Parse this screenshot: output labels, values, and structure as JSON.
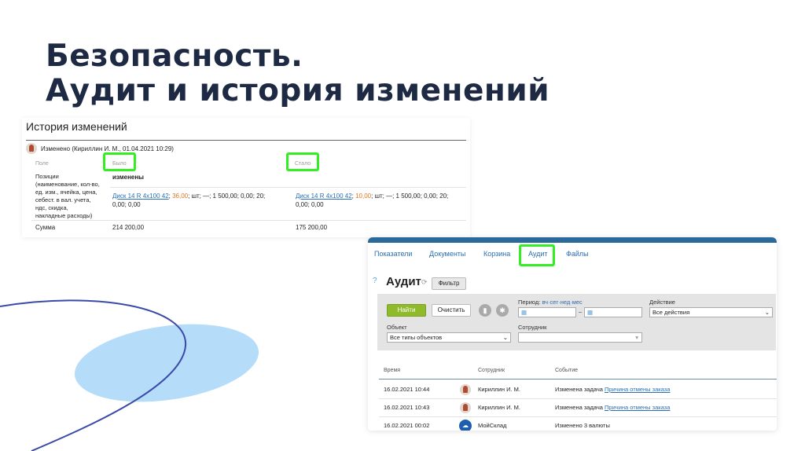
{
  "slide": {
    "title_line1": "Безопасность.",
    "title_line2": "Аудит и история изменений"
  },
  "history": {
    "title": "История изменений",
    "changed_by": "Изменено (Кириллин И. М., 01.04.2021 10:29)",
    "col_field": "Поле",
    "col_was": "Было",
    "col_became": "Стало",
    "positions_label": "Позиции (наименование, кол-во, ед. изм., ячейка, цена, себест. в вал. учета, ндс, скидка, накладные расходы)",
    "positions_status": "изменены",
    "was": {
      "link": "Диск 14 R 4x100 42",
      "sep": "; ",
      "qty": "36,00",
      "rest": "; шт; —; 1 500,00; 0,00; 20;",
      "rest2": "0,00; 0,00"
    },
    "became": {
      "link": "Диск 14 R 4x100 42",
      "sep": "; ",
      "qty": "10,00",
      "rest": "; шт; —; 1 500,00; 0,00; 20;",
      "rest2": "0,00; 0,00"
    },
    "sum_label": "Сумма",
    "sum_was": "214 200,00",
    "sum_became": "175 200,00"
  },
  "audit": {
    "tabs": [
      "Показатели",
      "Документы",
      "Корзина",
      "Аудит",
      "Файлы"
    ],
    "active_tab": "Аудит",
    "heading": "Аудит",
    "filter_button": "Фильтр",
    "find_button": "Найти",
    "clear_button": "Очистить",
    "period_label": "Период:",
    "period_links": "вч·сег·нед·мес",
    "period_dash": "–",
    "action_label": "Действие",
    "action_value": "Все действия",
    "object_label": "Объект",
    "object_value": "Все типы объектов",
    "employee_label": "Сотрудник",
    "employee_value": "",
    "columns": [
      "Время",
      "Сотрудник",
      "Событие"
    ],
    "rows": [
      {
        "time": "16.02.2021 10:44",
        "employee": "Кириллин И. М.",
        "event": "Изменена задача ",
        "event_link": "Причина отмены заказа",
        "avatar": "user"
      },
      {
        "time": "16.02.2021 10:43",
        "employee": "Кириллин И. М.",
        "event": "Изменена задача ",
        "event_link": "Причина отмены заказа",
        "avatar": "user"
      },
      {
        "time": "16.02.2021 00:02",
        "employee": "МойСклад",
        "event": "Изменено 3 валюты",
        "event_link": "",
        "avatar": "system"
      }
    ]
  },
  "colors": {
    "highlight": "#33ee22",
    "link": "#2c6fb0",
    "title": "#1e2a43",
    "deco_fill": "#b5dcf8",
    "deco_line": "#3b4aa8"
  }
}
